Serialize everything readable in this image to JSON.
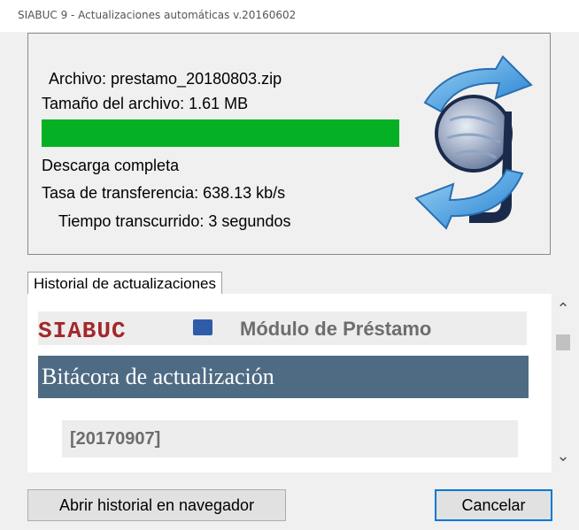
{
  "window": {
    "title": "SIABUC 9 - Actualizaciones automáticas v.20160602"
  },
  "status": {
    "file": "Archivo: prestamo_20180803.zip",
    "size": "Tamaño del archivo: 1.61 MB",
    "progress": 1.0,
    "progress_color": "#06b025",
    "state": "Descarga completa",
    "rate": "Tasa de transferencia: 638.13 kb/s",
    "elapsed": "Tiempo transcurrido: 3 segundos"
  },
  "history": {
    "tab_label": "Historial de actualizaciones",
    "brand": "SIABUC",
    "module_title": "Módulo de Préstamo",
    "log_title": "Bitácora de actualización",
    "version": "[20170907]"
  },
  "buttons": {
    "open_history": "Abrir historial en navegador",
    "cancel": "Cancelar"
  }
}
